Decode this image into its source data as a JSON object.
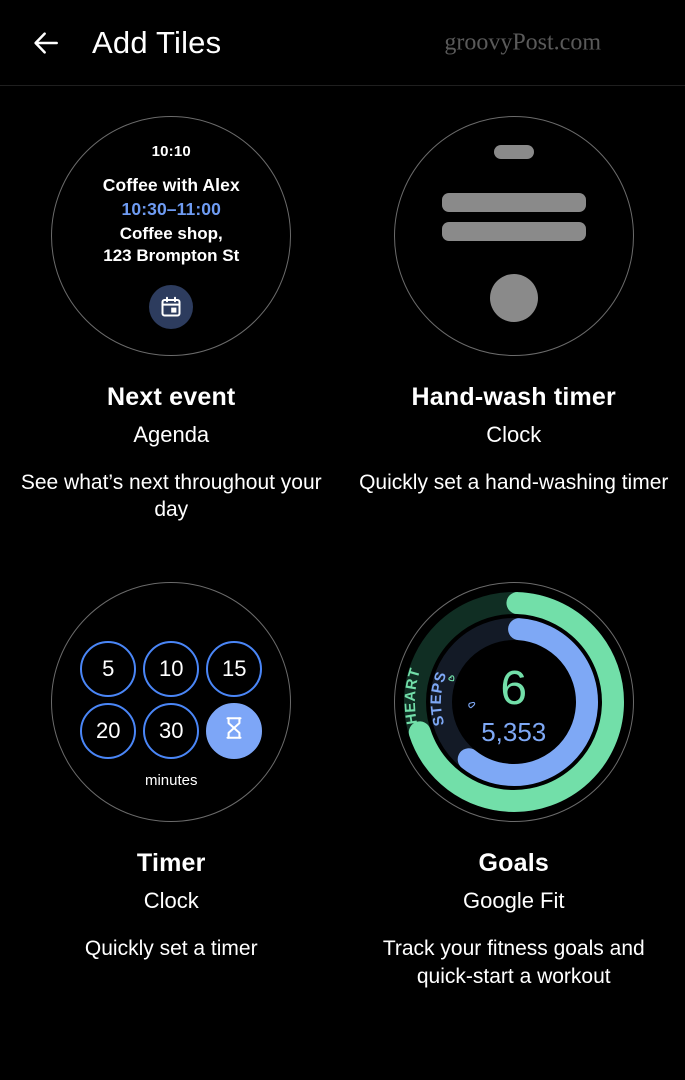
{
  "header": {
    "back_icon": "arrow-left-icon",
    "title": "Add Tiles",
    "watermark": "groovyPost.com"
  },
  "theme": {
    "background": "#000000",
    "text": "#ffffff",
    "blue_accent": "#4a86f7",
    "blue_light": "#7da6f7",
    "blue_text": "#6e9bf2",
    "green_accent": "#72dfa9",
    "skeleton_gray": "#8a8a8a",
    "circle_outline": "#6b6b6b",
    "calendar_badge": "#2d3c5e"
  },
  "tiles": [
    {
      "title": "Next event",
      "app": "Agenda",
      "description": "See what’s next throughout your day",
      "preview": {
        "kind": "agenda",
        "clock": "10:10",
        "event_title": "Coffee with Alex",
        "event_range": "10:30–11:00",
        "location_line1": "Coffee shop,",
        "location_line2": "123 Brompton St",
        "icon": "calendar-icon"
      }
    },
    {
      "title": "Hand-wash timer",
      "app": "Clock",
      "description": "Quickly set a hand-washing timer",
      "preview": {
        "kind": "skeleton",
        "shapes": [
          "pill",
          "bar",
          "bar",
          "dot"
        ]
      }
    },
    {
      "title": "Timer",
      "app": "Clock",
      "description": "Quickly set a timer",
      "preview": {
        "kind": "timer",
        "durations_row1": [
          "5",
          "10",
          "15"
        ],
        "durations_row2": [
          "20",
          "30"
        ],
        "custom_icon": "hourglass-icon",
        "units_label": "minutes"
      }
    },
    {
      "title": "Goals",
      "app": "Google Fit",
      "description": "Track your fitness goals and quick-start a workout",
      "preview": {
        "kind": "goals",
        "heart_label": "HEART",
        "heart_icon": "heart-icon",
        "heart_value": "6",
        "heart_progress_deg": 250,
        "steps_label": "STEPS",
        "steps_icon": "shoe-icon",
        "steps_value": "5,353",
        "steps_progress_deg": 214
      }
    }
  ]
}
